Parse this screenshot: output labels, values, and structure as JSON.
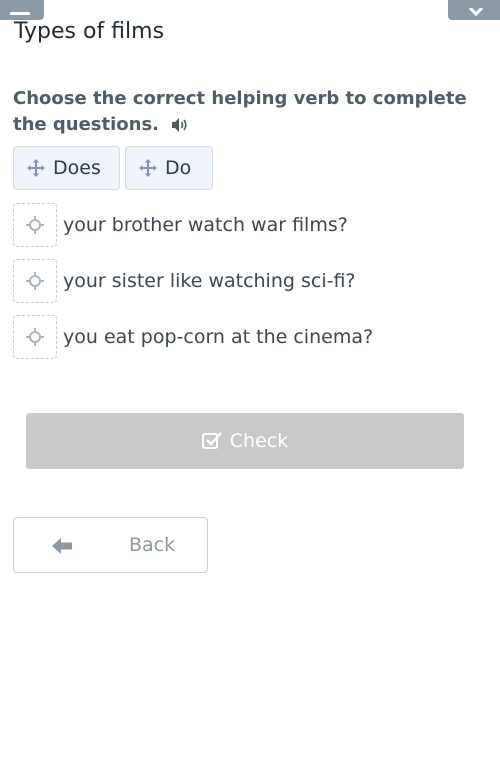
{
  "header": {
    "title": "Types of films"
  },
  "exercise": {
    "instruction": "Choose the correct helping verb to complete the questions.",
    "options": [
      "Does",
      "Do"
    ],
    "questions": [
      {
        "text": "your brother watch war films?"
      },
      {
        "text": "your sister like watching sci-fi?"
      },
      {
        "text": "you eat pop-corn at the cinema?"
      }
    ]
  },
  "buttons": {
    "check_label": "Check",
    "back_label": "Back"
  },
  "icons": {
    "menu": "menu-icon",
    "close": "close-icon",
    "speaker": "speaker-icon",
    "move": "move-icon",
    "drop_target": "crosshair-icon",
    "check": "checkbox-icon",
    "back": "arrow-left-icon"
  },
  "colors": {
    "chip_bg": "#eef4fa",
    "chip_border": "#cfdceb",
    "check_disabled": "#c9c9c9",
    "top_buttons": "#8c99a6",
    "instruction_text": "#4f5d6a"
  }
}
